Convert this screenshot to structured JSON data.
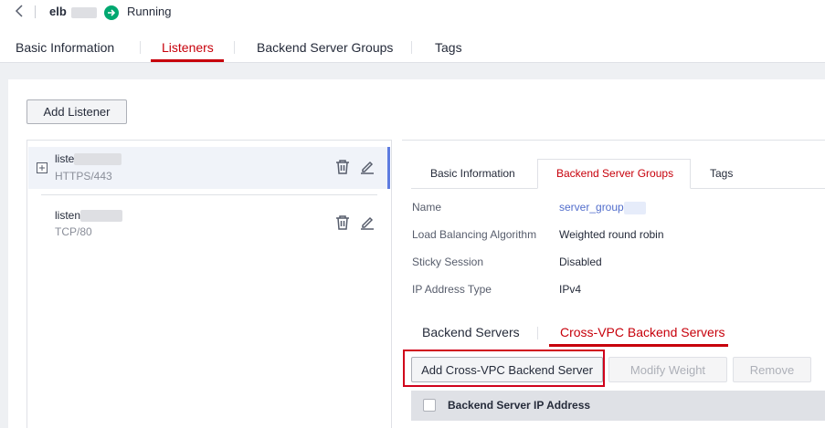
{
  "header": {
    "back_icon": "chevron-left-icon",
    "elb_name": "elb",
    "status_icon": "arrow-right-circle-icon",
    "status_color": "#00a870",
    "status_text": "Running"
  },
  "main_tabs": [
    {
      "label": "Basic Information",
      "active": false
    },
    {
      "label": "Listeners",
      "active": true
    },
    {
      "label": "Backend Server Groups",
      "active": false
    },
    {
      "label": "Tags",
      "active": false
    }
  ],
  "toolbar": {
    "add_listener_label": "Add Listener"
  },
  "listeners": [
    {
      "name": "liste",
      "protocol_port": "HTTPS/443",
      "selected": true
    },
    {
      "name": "listen",
      "protocol_port": "TCP/80",
      "selected": false
    }
  ],
  "detail": {
    "tabs": [
      {
        "label": "Basic Information",
        "active": false
      },
      {
        "label": "Backend Server Groups",
        "active": true
      },
      {
        "label": "Tags",
        "active": false
      }
    ],
    "fields": [
      {
        "label": "Name",
        "value": "server_group",
        "link": true
      },
      {
        "label": "Load Balancing Algorithm",
        "value": "Weighted round robin",
        "link": false
      },
      {
        "label": "Sticky Session",
        "value": "Disabled",
        "link": false
      },
      {
        "label": "IP Address Type",
        "value": "IPv4",
        "link": false
      }
    ],
    "section_tabs": [
      {
        "label": "Backend Servers",
        "active": false
      },
      {
        "label": "Cross-VPC Backend Servers",
        "active": true
      }
    ],
    "buttons": {
      "add_cross_vpc": "Add Cross-VPC Backend Server",
      "modify_weight": "Modify Weight",
      "remove": "Remove"
    },
    "table": {
      "column_ip": "Backend Server IP Address"
    }
  },
  "colors": {
    "accent": "#c7000b",
    "link": "#526ecc",
    "highlight_box": "#d0021b"
  }
}
